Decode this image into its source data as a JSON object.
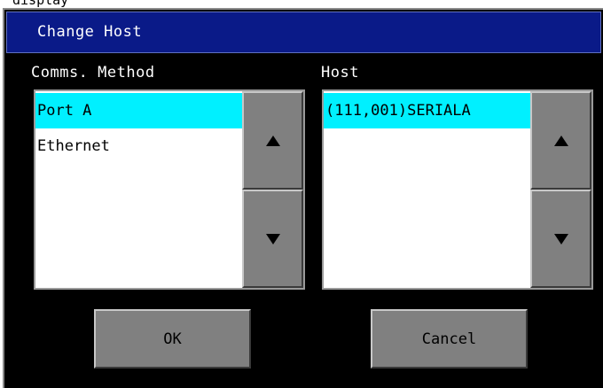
{
  "caption": "display",
  "dialog": {
    "title": "Change Host",
    "comms": {
      "label": "Comms. Method",
      "items": [
        {
          "label": "Port A",
          "selected": true
        },
        {
          "label": "Ethernet",
          "selected": false
        }
      ]
    },
    "host": {
      "label": "Host",
      "items": [
        {
          "label": "(111,001)SERIALA",
          "selected": true
        }
      ]
    },
    "buttons": {
      "ok_label": "OK",
      "cancel_label": "Cancel"
    }
  },
  "colors": {
    "titlebar": "#0a1a88",
    "selection": "#00f0ff",
    "button_face": "#808080"
  },
  "icons": {
    "scroll_up": "up-triangle",
    "scroll_down": "down-triangle"
  }
}
